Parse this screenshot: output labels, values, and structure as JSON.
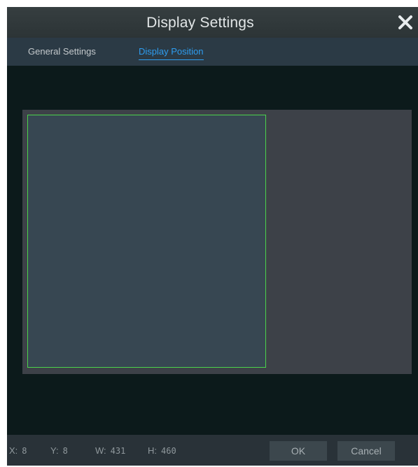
{
  "dialog": {
    "title": "Display Settings",
    "close_icon": "close-icon"
  },
  "tabs": [
    {
      "label": "General Settings",
      "active": false
    },
    {
      "label": "Display Position",
      "active": true
    }
  ],
  "position": {
    "x_label": "X:",
    "x_value": "8",
    "y_label": "Y:",
    "y_value": "8",
    "w_label": "W:",
    "w_value": "431",
    "h_label": "H:",
    "h_value": "460"
  },
  "buttons": {
    "ok": "OK",
    "cancel": "Cancel"
  },
  "colors": {
    "background": "#0c1a1b",
    "titlebar": "#2f3739",
    "tabbar": "#2b3a45",
    "active_tab": "#2e9df0",
    "canvas": "#3d4148",
    "position_fill": "#374752",
    "position_border": "#4bd34b",
    "footer": "#293238"
  }
}
